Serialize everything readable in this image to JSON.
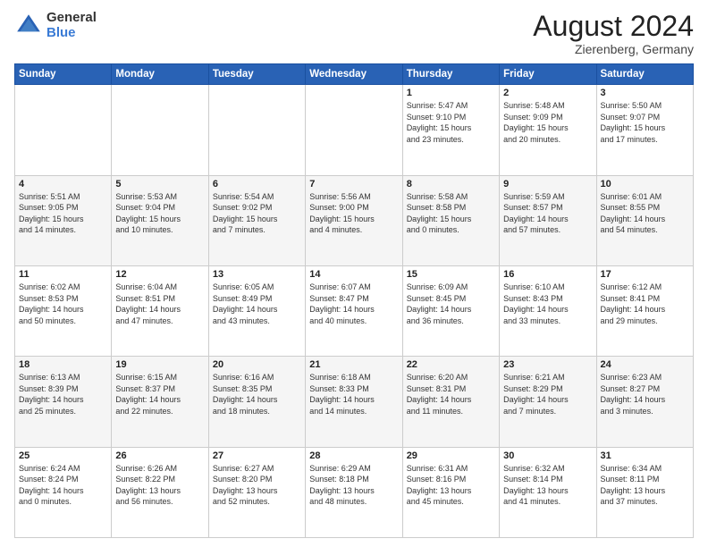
{
  "header": {
    "logo_general": "General",
    "logo_blue": "Blue",
    "month_title": "August 2024",
    "subtitle": "Zierenberg, Germany"
  },
  "days_of_week": [
    "Sunday",
    "Monday",
    "Tuesday",
    "Wednesday",
    "Thursday",
    "Friday",
    "Saturday"
  ],
  "weeks": [
    [
      {
        "day": "",
        "info": ""
      },
      {
        "day": "",
        "info": ""
      },
      {
        "day": "",
        "info": ""
      },
      {
        "day": "",
        "info": ""
      },
      {
        "day": "1",
        "info": "Sunrise: 5:47 AM\nSunset: 9:10 PM\nDaylight: 15 hours\nand 23 minutes."
      },
      {
        "day": "2",
        "info": "Sunrise: 5:48 AM\nSunset: 9:09 PM\nDaylight: 15 hours\nand 20 minutes."
      },
      {
        "day": "3",
        "info": "Sunrise: 5:50 AM\nSunset: 9:07 PM\nDaylight: 15 hours\nand 17 minutes."
      }
    ],
    [
      {
        "day": "4",
        "info": "Sunrise: 5:51 AM\nSunset: 9:05 PM\nDaylight: 15 hours\nand 14 minutes."
      },
      {
        "day": "5",
        "info": "Sunrise: 5:53 AM\nSunset: 9:04 PM\nDaylight: 15 hours\nand 10 minutes."
      },
      {
        "day": "6",
        "info": "Sunrise: 5:54 AM\nSunset: 9:02 PM\nDaylight: 15 hours\nand 7 minutes."
      },
      {
        "day": "7",
        "info": "Sunrise: 5:56 AM\nSunset: 9:00 PM\nDaylight: 15 hours\nand 4 minutes."
      },
      {
        "day": "8",
        "info": "Sunrise: 5:58 AM\nSunset: 8:58 PM\nDaylight: 15 hours\nand 0 minutes."
      },
      {
        "day": "9",
        "info": "Sunrise: 5:59 AM\nSunset: 8:57 PM\nDaylight: 14 hours\nand 57 minutes."
      },
      {
        "day": "10",
        "info": "Sunrise: 6:01 AM\nSunset: 8:55 PM\nDaylight: 14 hours\nand 54 minutes."
      }
    ],
    [
      {
        "day": "11",
        "info": "Sunrise: 6:02 AM\nSunset: 8:53 PM\nDaylight: 14 hours\nand 50 minutes."
      },
      {
        "day": "12",
        "info": "Sunrise: 6:04 AM\nSunset: 8:51 PM\nDaylight: 14 hours\nand 47 minutes."
      },
      {
        "day": "13",
        "info": "Sunrise: 6:05 AM\nSunset: 8:49 PM\nDaylight: 14 hours\nand 43 minutes."
      },
      {
        "day": "14",
        "info": "Sunrise: 6:07 AM\nSunset: 8:47 PM\nDaylight: 14 hours\nand 40 minutes."
      },
      {
        "day": "15",
        "info": "Sunrise: 6:09 AM\nSunset: 8:45 PM\nDaylight: 14 hours\nand 36 minutes."
      },
      {
        "day": "16",
        "info": "Sunrise: 6:10 AM\nSunset: 8:43 PM\nDaylight: 14 hours\nand 33 minutes."
      },
      {
        "day": "17",
        "info": "Sunrise: 6:12 AM\nSunset: 8:41 PM\nDaylight: 14 hours\nand 29 minutes."
      }
    ],
    [
      {
        "day": "18",
        "info": "Sunrise: 6:13 AM\nSunset: 8:39 PM\nDaylight: 14 hours\nand 25 minutes."
      },
      {
        "day": "19",
        "info": "Sunrise: 6:15 AM\nSunset: 8:37 PM\nDaylight: 14 hours\nand 22 minutes."
      },
      {
        "day": "20",
        "info": "Sunrise: 6:16 AM\nSunset: 8:35 PM\nDaylight: 14 hours\nand 18 minutes."
      },
      {
        "day": "21",
        "info": "Sunrise: 6:18 AM\nSunset: 8:33 PM\nDaylight: 14 hours\nand 14 minutes."
      },
      {
        "day": "22",
        "info": "Sunrise: 6:20 AM\nSunset: 8:31 PM\nDaylight: 14 hours\nand 11 minutes."
      },
      {
        "day": "23",
        "info": "Sunrise: 6:21 AM\nSunset: 8:29 PM\nDaylight: 14 hours\nand 7 minutes."
      },
      {
        "day": "24",
        "info": "Sunrise: 6:23 AM\nSunset: 8:27 PM\nDaylight: 14 hours\nand 3 minutes."
      }
    ],
    [
      {
        "day": "25",
        "info": "Sunrise: 6:24 AM\nSunset: 8:24 PM\nDaylight: 14 hours\nand 0 minutes."
      },
      {
        "day": "26",
        "info": "Sunrise: 6:26 AM\nSunset: 8:22 PM\nDaylight: 13 hours\nand 56 minutes."
      },
      {
        "day": "27",
        "info": "Sunrise: 6:27 AM\nSunset: 8:20 PM\nDaylight: 13 hours\nand 52 minutes."
      },
      {
        "day": "28",
        "info": "Sunrise: 6:29 AM\nSunset: 8:18 PM\nDaylight: 13 hours\nand 48 minutes."
      },
      {
        "day": "29",
        "info": "Sunrise: 6:31 AM\nSunset: 8:16 PM\nDaylight: 13 hours\nand 45 minutes."
      },
      {
        "day": "30",
        "info": "Sunrise: 6:32 AM\nSunset: 8:14 PM\nDaylight: 13 hours\nand 41 minutes."
      },
      {
        "day": "31",
        "info": "Sunrise: 6:34 AM\nSunset: 8:11 PM\nDaylight: 13 hours\nand 37 minutes."
      }
    ]
  ]
}
